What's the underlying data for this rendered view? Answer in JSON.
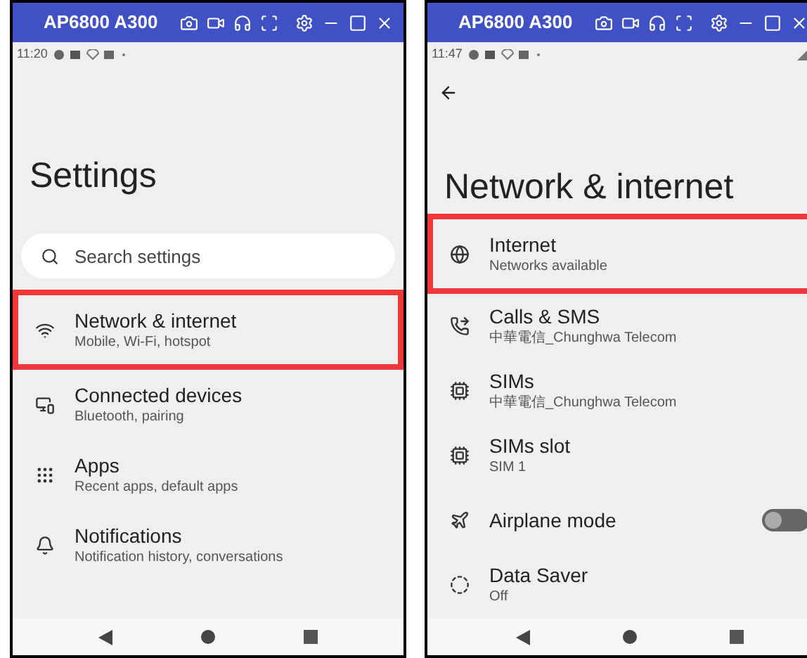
{
  "panels": [
    {
      "window": {
        "title": "AP6800 A300"
      },
      "status_bar": {
        "time": "11:20",
        "signal_icon": false
      },
      "back_button": false,
      "page_title": "Settings",
      "search": {
        "placeholder": "Search settings"
      },
      "items": [
        {
          "kind": "wifi",
          "title": "Network & internet",
          "subtitle": "Mobile, Wi-Fi, hotspot",
          "selected": true
        },
        {
          "kind": "devices",
          "title": "Connected devices",
          "subtitle": "Bluetooth, pairing",
          "selected": false
        },
        {
          "kind": "apps",
          "title": "Apps",
          "subtitle": "Recent apps, default apps",
          "selected": false
        },
        {
          "kind": "bell",
          "title": "Notifications",
          "subtitle": "Notification history, conversations",
          "selected": false
        }
      ]
    },
    {
      "window": {
        "title": "AP6800 A300"
      },
      "status_bar": {
        "time": "11:47",
        "signal_icon": true
      },
      "back_button": true,
      "page_title": "Network & internet",
      "items": [
        {
          "kind": "globe",
          "title": "Internet",
          "subtitle": "Networks available",
          "selected": true
        },
        {
          "kind": "calls",
          "title": "Calls & SMS",
          "subtitle": "中華電信_Chunghwa Telecom",
          "selected": false
        },
        {
          "kind": "sim",
          "title": "SIMs",
          "subtitle": "中華電信_Chunghwa Telecom",
          "selected": false
        },
        {
          "kind": "sim",
          "title": "SIMs slot",
          "subtitle": "SIM 1",
          "selected": false
        },
        {
          "kind": "airplane",
          "title": "Airplane mode",
          "selected": false,
          "toggle": {
            "on": false
          }
        },
        {
          "kind": "datasaver",
          "title": "Data Saver",
          "subtitle": "Off",
          "selected": false
        }
      ]
    }
  ]
}
